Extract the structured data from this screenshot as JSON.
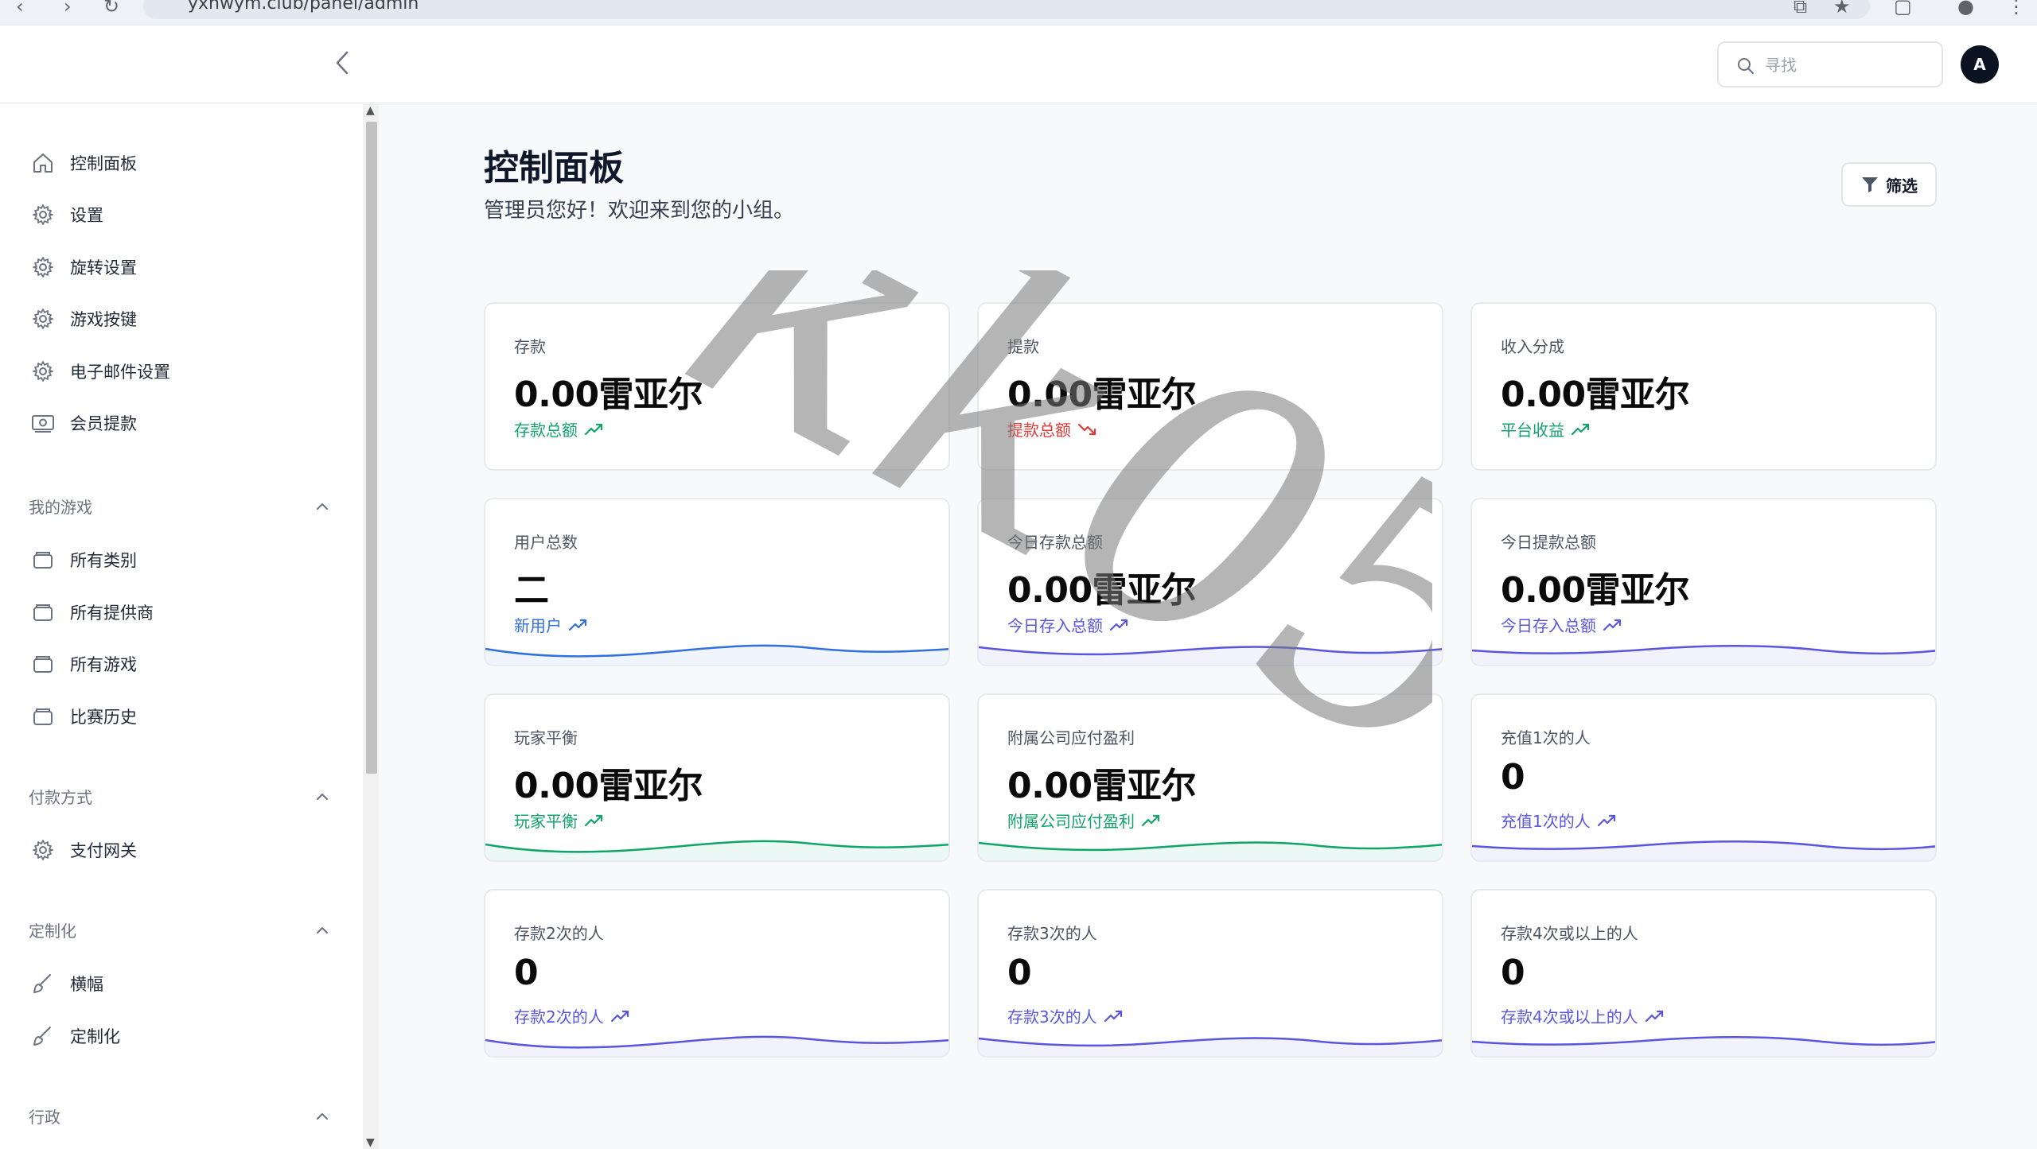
{
  "browser": {
    "url": "yxhwym.club/panel/admin"
  },
  "header": {
    "search_placeholder": "寻找",
    "avatar_initial": "A"
  },
  "sidebar": {
    "main_items": [
      {
        "label": "控制面板",
        "icon": "home-icon"
      },
      {
        "label": "设置",
        "icon": "gear-icon"
      },
      {
        "label": "旋转设置",
        "icon": "gear-icon"
      },
      {
        "label": "游戏按键",
        "icon": "gear-icon"
      },
      {
        "label": "电子邮件设置",
        "icon": "gear-icon"
      },
      {
        "label": "会员提款",
        "icon": "cash-icon"
      }
    ],
    "sections": [
      {
        "title": "我的游戏",
        "items": [
          "所有类别",
          "所有提供商",
          "所有游戏",
          "比赛历史"
        ]
      },
      {
        "title": "付款方式",
        "items": [
          "支付网关"
        ]
      },
      {
        "title": "定制化",
        "items": [
          "横幅",
          "定制化"
        ]
      },
      {
        "title": "行政",
        "items": []
      }
    ]
  },
  "main": {
    "title": "控制面板",
    "subtitle": "管理员您好！欢迎来到您的小组。",
    "filter_label": "筛选"
  },
  "cards": [
    {
      "label": "存款",
      "value": "0.00雷亚尔",
      "foot": "存款总额",
      "tone": "green",
      "trend": "up",
      "spark": false
    },
    {
      "label": "提款",
      "value": "0.00雷亚尔",
      "foot": "提款总额",
      "tone": "red",
      "trend": "down",
      "spark": false
    },
    {
      "label": "收入分成",
      "value": "0.00雷亚尔",
      "foot": "平台收益",
      "tone": "green",
      "trend": "up",
      "spark": false
    },
    {
      "label": "用户总数",
      "value": "二",
      "foot": "新用户",
      "tone": "blue",
      "trend": "up",
      "spark": true
    },
    {
      "label": "今日存款总额",
      "value": "0.00雷亚尔",
      "foot": "今日存入总额",
      "tone": "indigo",
      "trend": "up",
      "spark": true
    },
    {
      "label": "今日提款总额",
      "value": "0.00雷亚尔",
      "foot": "今日存入总额",
      "tone": "indigo",
      "trend": "up",
      "spark": true
    },
    {
      "label": "玩家平衡",
      "value": "0.00雷亚尔",
      "foot": "玩家平衡",
      "tone": "green",
      "trend": "up",
      "spark": true
    },
    {
      "label": "附属公司应付盈利",
      "value": "0.00雷亚尔",
      "foot": "附属公司应付盈利",
      "tone": "green",
      "trend": "up",
      "spark": true
    },
    {
      "label": "充值1次的人",
      "value": "0",
      "foot": "充值1次的人",
      "tone": "indigo",
      "trend": "up",
      "spark": true
    },
    {
      "label": "存款2次的人",
      "value": "0",
      "foot": "存款2次的人",
      "tone": "indigo",
      "trend": "up",
      "spark": true
    },
    {
      "label": "存款3次的人",
      "value": "0",
      "foot": "存款3次的人",
      "tone": "indigo",
      "trend": "up",
      "spark": true
    },
    {
      "label": "存款4次或以上的人",
      "value": "0",
      "foot": "存款4次或以上的人",
      "tone": "indigo",
      "trend": "up",
      "spark": true
    }
  ],
  "colors": {
    "green": "#10a36a",
    "red": "#e23a3a",
    "blue": "#2f6fe0",
    "indigo": "#5a55e0"
  },
  "watermark": "kk058"
}
